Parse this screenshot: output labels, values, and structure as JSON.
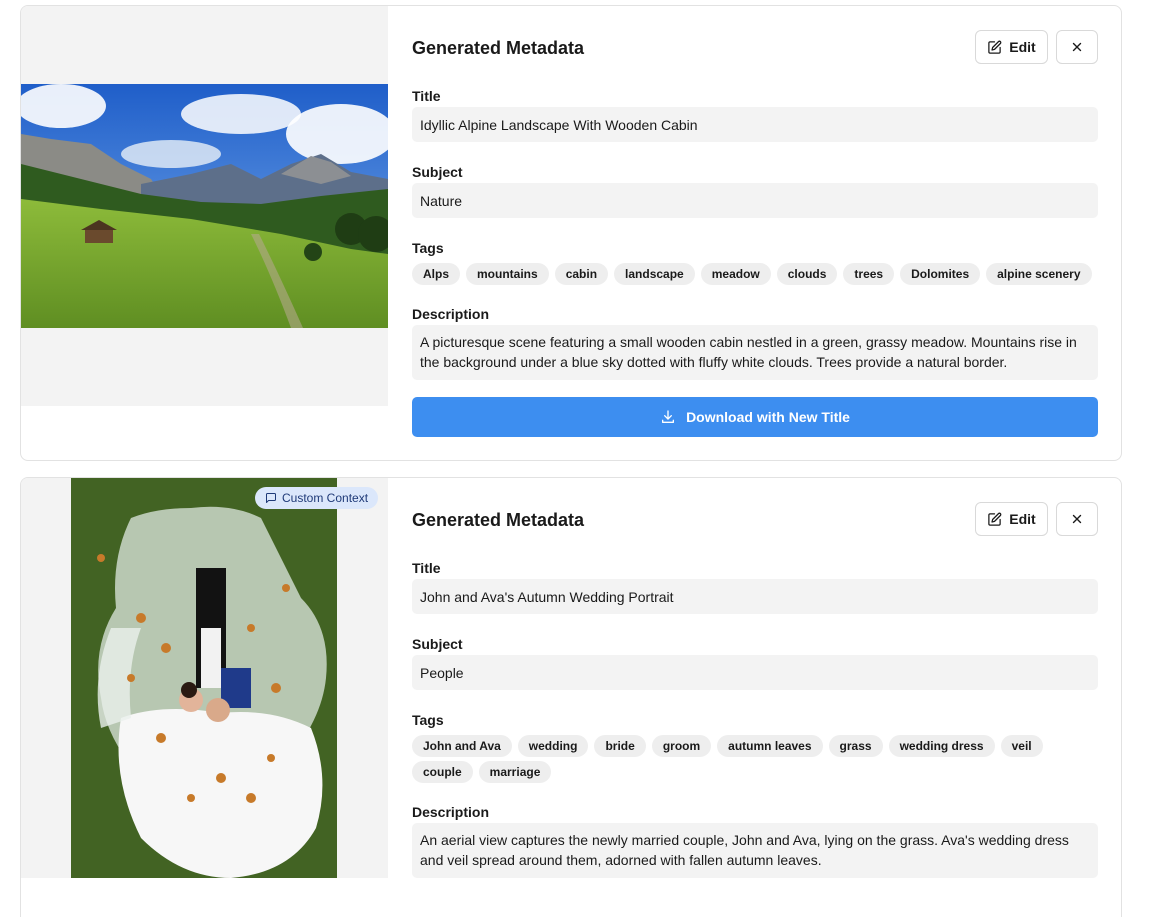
{
  "cards": [
    {
      "heading": "Generated Metadata",
      "edit_label": "Edit",
      "title_label": "Title",
      "title_value": "Idyllic Alpine Landscape With Wooden Cabin",
      "subject_label": "Subject",
      "subject_value": "Nature",
      "tags_label": "Tags",
      "tags": [
        "Alps",
        "mountains",
        "cabin",
        "landscape",
        "meadow",
        "clouds",
        "trees",
        "Dolomites",
        "alpine scenery"
      ],
      "description_label": "Description",
      "description_value": "A picturesque scene featuring a small wooden cabin nestled in a green, grassy meadow. Mountains rise in the background under a blue sky dotted with fluffy white clouds. Trees provide a natural border.",
      "download_label": "Download with New Title"
    },
    {
      "badge": "Custom Context",
      "heading": "Generated Metadata",
      "edit_label": "Edit",
      "title_label": "Title",
      "title_value": "John and Ava's Autumn Wedding Portrait",
      "subject_label": "Subject",
      "subject_value": "People",
      "tags_label": "Tags",
      "tags": [
        "John and Ava",
        "wedding",
        "bride",
        "groom",
        "autumn leaves",
        "grass",
        "wedding dress",
        "veil",
        "couple",
        "marriage"
      ],
      "description_label": "Description",
      "description_value": "An aerial view captures the newly married couple, John and Ava, lying on the grass. Ava's wedding dress and veil spread around them, adorned with fallen autumn leaves."
    }
  ],
  "icons": {
    "edit": "pencil-square-icon",
    "close": "x-icon",
    "download": "download-icon",
    "badge": "message-square-icon"
  },
  "colors": {
    "primary": "#3d8ef0",
    "field_bg": "#f3f3f3",
    "tag_bg": "#eeeeee",
    "badge_bg": "#dbe7fb"
  }
}
